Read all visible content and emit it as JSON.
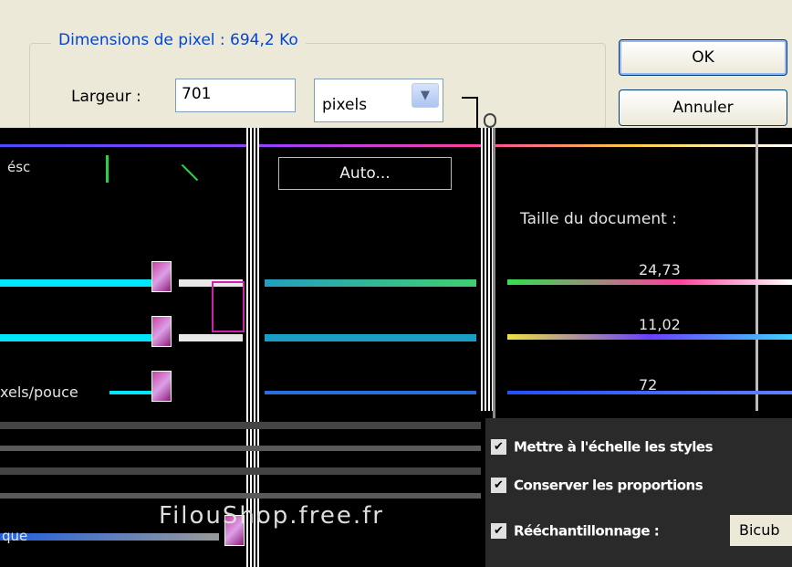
{
  "dialog": {
    "pixel_dims_legend": "Dimensions de pixel :  694,2 Ko",
    "width_label": "Largeur :",
    "width_value": "701",
    "width_unit": "pixels",
    "ok_label": "OK",
    "cancel_label": "Annuler",
    "auto_label": "Auto...",
    "doc_size_legend": "Taille du document :",
    "doc_width_value": "24,73",
    "doc_height_value": "11,02",
    "resolution_value": "72",
    "resolution_unit": "xels/pouce",
    "check_scale_styles": "Mettre à l'échelle les styles",
    "check_proportions": "Conserver les proportions",
    "check_resample": "Rééchantillonnage :",
    "resample_method": "Bicub",
    "left_partial_text": "que",
    "left_partial_text2": "ésc"
  },
  "watermark": "FilouShop.free.fr",
  "colors": {
    "dialog_bg": "#ece9d8",
    "legend_blue": "#0046d5",
    "glitch_cyan": "#00e5ff"
  }
}
